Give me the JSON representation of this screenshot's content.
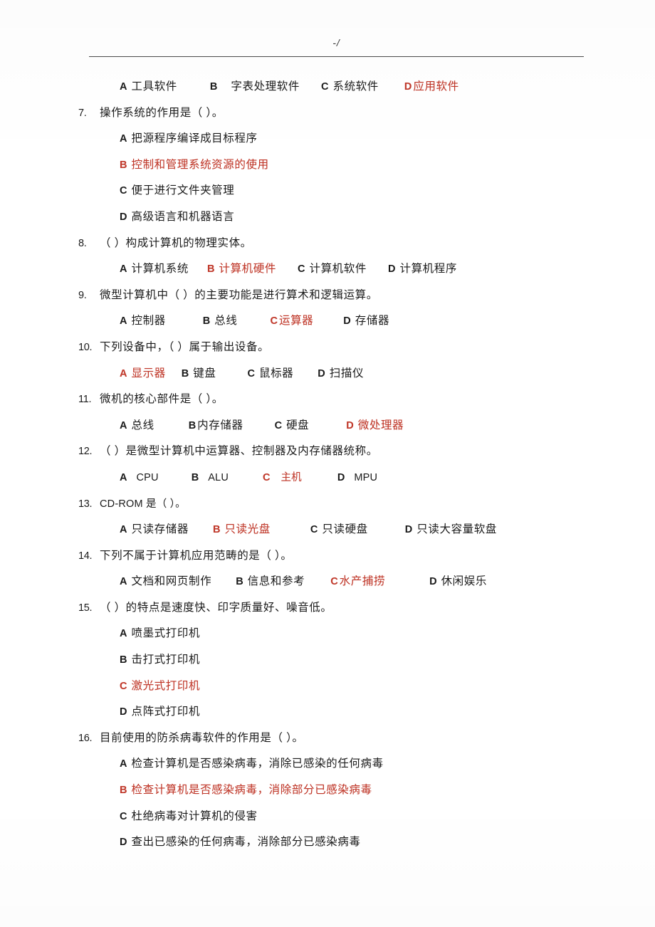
{
  "document": {
    "header": {
      "page_marker": "-/"
    },
    "answer_color": "#c0392b",
    "body_color": "#1a1a1a",
    "questions": [
      {
        "number": "",
        "stem": "",
        "has_stem": false,
        "option_layout": "inline",
        "options": [
          {
            "letter": "A",
            "label": "工具软件",
            "gap": 0,
            "answer": false
          },
          {
            "letter": "B",
            "label": "字表处理软件",
            "gap": 46,
            "answer": false,
            "letter_gap": 18
          },
          {
            "letter": "C",
            "label": "系统软件",
            "gap": 30,
            "answer": false
          },
          {
            "letter": "D",
            "label": "应用软件",
            "gap": 36,
            "answer": true,
            "tight": true
          }
        ]
      },
      {
        "number": "7.",
        "stem": "操作系统的作用是（   ）。",
        "has_stem": true,
        "option_layout": "stacked",
        "options": [
          {
            "letter": "A",
            "label": "把源程序编译成目标程序",
            "answer": false
          },
          {
            "letter": "B",
            "label": "控制和管理系统资源的使用",
            "answer": true
          },
          {
            "letter": "C",
            "label": "便于进行文件夹管理",
            "answer": false
          },
          {
            "letter": "D",
            "label": "高级语言和机器语言",
            "answer": false
          }
        ]
      },
      {
        "number": "8.",
        "stem": "（   ）构成计算机的物理实体。",
        "has_stem": true,
        "option_layout": "inline",
        "options": [
          {
            "letter": "A",
            "label": "计算机系统",
            "gap": 0,
            "answer": false
          },
          {
            "letter": "B",
            "label": "计算机硬件",
            "gap": 26,
            "answer": true
          },
          {
            "letter": "C",
            "label": "计算机软件",
            "gap": 30,
            "answer": false
          },
          {
            "letter": "D",
            "label": "计算机程序",
            "gap": 30,
            "answer": false
          }
        ]
      },
      {
        "number": "9.",
        "stem": "微型计算机中（   ）的主要功能是进行算术和逻辑运算。",
        "has_stem": true,
        "option_layout": "inline",
        "options": [
          {
            "letter": "A",
            "label": "控制器",
            "gap": 0,
            "answer": false
          },
          {
            "letter": "B",
            "label": "总线",
            "gap": 52,
            "answer": false
          },
          {
            "letter": "C",
            "label": "运算器",
            "gap": 46,
            "answer": true,
            "tight": true
          },
          {
            "letter": "D",
            "label": "存储器",
            "gap": 42,
            "answer": false
          }
        ]
      },
      {
        "number": "10.",
        "stem": "下列设备中，（   ）属于输出设备。",
        "has_stem": true,
        "option_layout": "inline",
        "options": [
          {
            "letter": "A",
            "label": "显示器",
            "gap": 0,
            "answer": true
          },
          {
            "letter": "B",
            "label": "键盘",
            "gap": 22,
            "answer": false
          },
          {
            "letter": "C",
            "label": "鼠标器",
            "gap": 44,
            "answer": false
          },
          {
            "letter": "D",
            "label": "扫描仪",
            "gap": 34,
            "answer": false
          }
        ]
      },
      {
        "number": "11.",
        "stem": "微机的核心部件是（   ）。",
        "has_stem": true,
        "option_layout": "inline",
        "options": [
          {
            "letter": "A",
            "label": "总线",
            "gap": 0,
            "answer": false
          },
          {
            "letter": "B",
            "label": "内存储器",
            "gap": 48,
            "answer": false,
            "tight": true
          },
          {
            "letter": "C",
            "label": "硬盘",
            "gap": 44,
            "answer": false
          },
          {
            "letter": "D",
            "label": "微处理器",
            "gap": 52,
            "answer": true
          }
        ]
      },
      {
        "number": "12.",
        "stem": "（   ）是微型计算机中运算器、控制器及内存储器统称。",
        "has_stem": true,
        "option_layout": "inline",
        "latin": true,
        "options": [
          {
            "letter": "A",
            "label": "CPU",
            "gap": 0,
            "answer": false,
            "letter_gap": 12
          },
          {
            "letter": "B",
            "label": "ALU",
            "gap": 46,
            "answer": false,
            "letter_gap": 12
          },
          {
            "letter": "C",
            "label": "主机",
            "gap": 48,
            "answer": true,
            "letter_gap": 14
          },
          {
            "letter": "D",
            "label": "MPU",
            "gap": 50,
            "answer": false,
            "letter_gap": 12
          }
        ]
      },
      {
        "number": "13.",
        "stem": "CD-ROM 是（   ）。",
        "has_stem": true,
        "stem_latin_prefix": "CD-ROM",
        "option_layout": "inline",
        "options": [
          {
            "letter": "A",
            "label": "只读存储器",
            "gap": 0,
            "answer": false
          },
          {
            "letter": "B",
            "label": "只读光盘",
            "gap": 34,
            "answer": true
          },
          {
            "letter": "C",
            "label": "只读硬盘",
            "gap": 56,
            "answer": false
          },
          {
            "letter": "D",
            "label": "只读大容量软盘",
            "gap": 52,
            "answer": false
          }
        ]
      },
      {
        "number": "14.",
        "stem": "下列不属于计算机应用范畴的是（   ）。",
        "has_stem": true,
        "option_layout": "inline",
        "options": [
          {
            "letter": "A",
            "label": "文档和网页制作",
            "gap": 0,
            "answer": false
          },
          {
            "letter": "B",
            "label": "信息和参考",
            "gap": 34,
            "answer": false
          },
          {
            "letter": "C",
            "label": "水产捕捞",
            "gap": 36,
            "answer": true,
            "tight": true
          },
          {
            "letter": "D",
            "label": "休闲娱乐",
            "gap": 62,
            "answer": false
          }
        ]
      },
      {
        "number": "15.",
        "stem": "（   ）的特点是速度快、印字质量好、噪音低。",
        "has_stem": true,
        "option_layout": "stacked",
        "options": [
          {
            "letter": "A",
            "label": "喷墨式打印机",
            "answer": false
          },
          {
            "letter": "B",
            "label": "击打式打印机",
            "answer": false
          },
          {
            "letter": "C",
            "label": "激光式打印机",
            "answer": true
          },
          {
            "letter": "D",
            "label": "点阵式打印机",
            "answer": false
          }
        ]
      },
      {
        "number": "16.",
        "stem": "目前使用的防杀病毒软件的作用是（   ）。",
        "has_stem": true,
        "option_layout": "stacked",
        "options": [
          {
            "letter": "A",
            "label": "检查计算机是否感染病毒，消除已感染的任何病毒",
            "answer": false
          },
          {
            "letter": "B",
            "label": "检查计算机是否感染病毒，消除部分已感染病毒",
            "answer": true
          },
          {
            "letter": "C",
            "label": "杜绝病毒对计算机的侵害",
            "answer": false
          },
          {
            "letter": "D",
            "label": "查出已感染的任何病毒，消除部分已感染病毒",
            "answer": false
          }
        ]
      }
    ]
  }
}
